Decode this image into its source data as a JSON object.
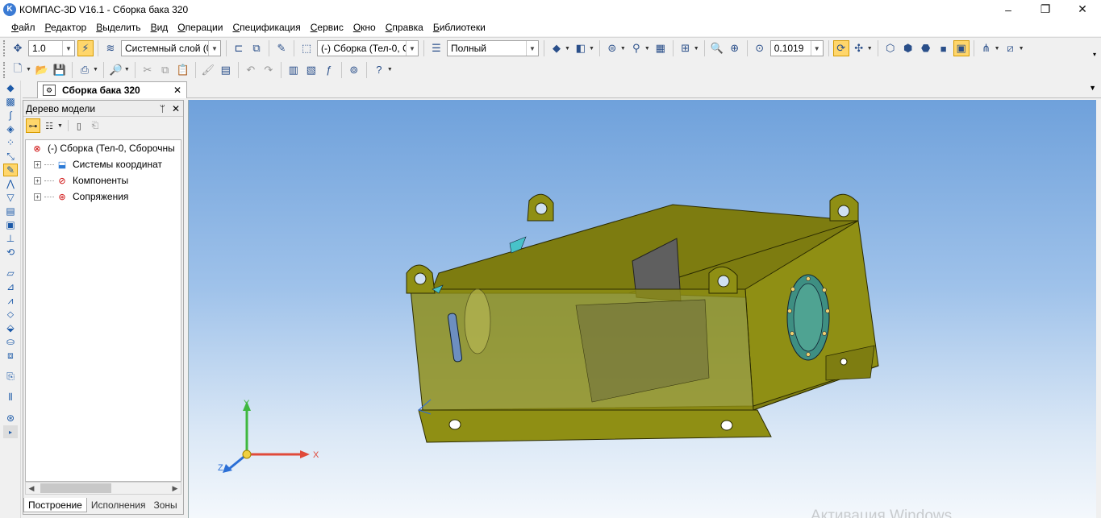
{
  "window": {
    "title": "КОМПАС-3D V16.1 - Сборка бака 320",
    "app_icon_letter": "K",
    "minimize": "–",
    "maximize": "❐",
    "close": "✕"
  },
  "menu": [
    "Файл",
    "Редактор",
    "Выделить",
    "Вид",
    "Операции",
    "Спецификация",
    "Сервис",
    "Окно",
    "Справка",
    "Библиотеки"
  ],
  "toolbar1": {
    "step_value": "1.0",
    "layer_value": "Системный слой (0)",
    "body_value": "(-) Сборка (Тел-0, С",
    "display_value": "Полный",
    "zoom_value": "0.1019"
  },
  "document_tab": {
    "label": "Сборка бака 320",
    "close": "✕"
  },
  "model_tree": {
    "title": "Дерево модели",
    "pin": "ᛘ",
    "close": "✕",
    "root": "(-) Сборка (Тел-0, Сборочны",
    "children": [
      "Системы координат",
      "Компоненты",
      "Сопряжения"
    ],
    "expander": "+",
    "tabs": [
      "Построение",
      "Исполнения",
      "Зоны"
    ]
  },
  "axes": {
    "x": "X",
    "y": "Y",
    "z": "Z"
  },
  "watermark": "Активация Windows",
  "colors": {
    "model_body": "#8f8f14",
    "model_dark": "#6d6c0f",
    "flange": "#3e8f82",
    "viewport_top": "#6fa1db",
    "highlight": "#ffd66b"
  }
}
